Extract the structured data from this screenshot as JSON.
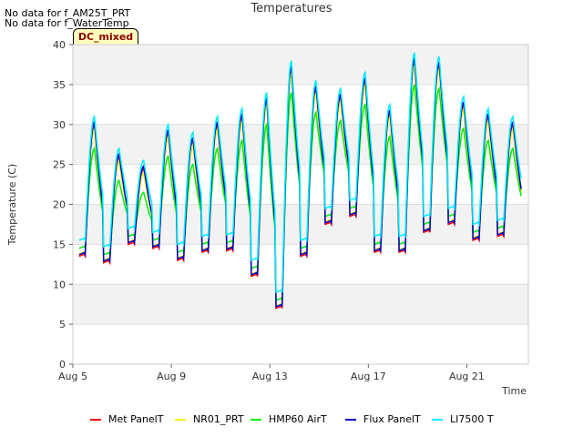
{
  "notes": [
    "No data for f_AM25T_PRT",
    "No data for f_WaterTemp"
  ],
  "badge": "DC_mixed",
  "chart_data": {
    "type": "line",
    "title": "Temperatures",
    "xlabel": "Time",
    "ylabel": "Temperature (C)",
    "ylim": [
      0,
      40
    ],
    "yticks": [
      0,
      5,
      10,
      15,
      20,
      25,
      30,
      35,
      40
    ],
    "xlim": [
      "2023-08-05",
      "2023-08-23"
    ],
    "xticks": [
      "Aug 5",
      "Aug 9",
      "Aug 13",
      "Aug 17",
      "Aug 21"
    ],
    "grid": "horizontal bands",
    "legend_position": "bottom",
    "x_days": [
      "Aug 5",
      "Aug 6",
      "Aug 7",
      "Aug 8",
      "Aug 9",
      "Aug 10",
      "Aug 11",
      "Aug 12",
      "Aug 13",
      "Aug 14",
      "Aug 15",
      "Aug 16",
      "Aug 17",
      "Aug 18",
      "Aug 19",
      "Aug 20",
      "Aug 21",
      "Aug 22"
    ],
    "daily_min": [
      13.5,
      12.7,
      15.0,
      14.5,
      13.0,
      14.0,
      14.2,
      11.0,
      7.0,
      13.5,
      17.5,
      18.5,
      14.0,
      14.0,
      16.5,
      17.5,
      15.5,
      16.0
    ],
    "daily_max": [
      30.0,
      26.0,
      24.5,
      29.0,
      28.0,
      30.0,
      31.0,
      33.0,
      37.0,
      34.5,
      33.5,
      35.5,
      31.5,
      38.0,
      37.5,
      32.5,
      31.0,
      30.0
    ],
    "series": [
      {
        "name": "Met PanelT",
        "color": "#ff0000",
        "min_offset": 0.0,
        "max_offset": 0.0
      },
      {
        "name": "NR01_PRT",
        "color": "#ffee00",
        "min_offset": 0.3,
        "max_offset": -0.6
      },
      {
        "name": "HMP60 AirT",
        "color": "#00ee00",
        "min_offset": 1.0,
        "max_offset": -3.0
      },
      {
        "name": "Flux PanelT",
        "color": "#0000cc",
        "min_offset": 0.2,
        "max_offset": 0.3
      },
      {
        "name": "LI7500 T",
        "color": "#00eeff",
        "min_offset": 2.0,
        "max_offset": 1.0
      }
    ]
  }
}
